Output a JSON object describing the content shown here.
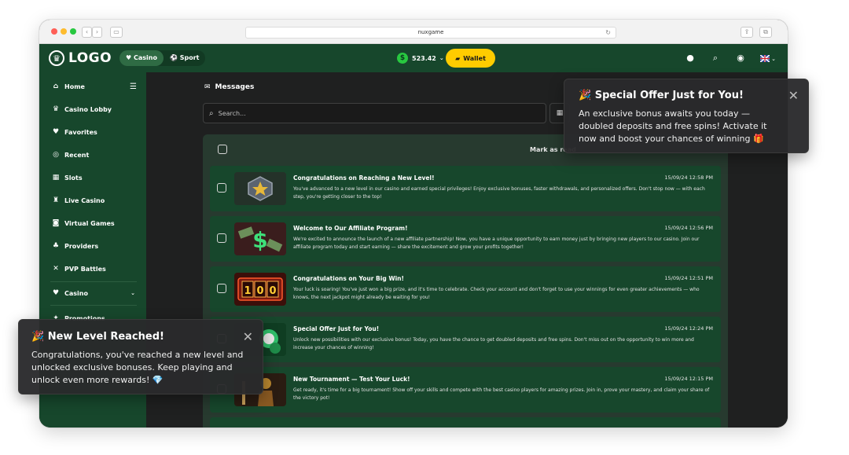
{
  "browser": {
    "url": "nuxgame",
    "reload_icon": "↻",
    "back_icon": "‹",
    "forward_icon": "›"
  },
  "topnav": {
    "logo_text": "LOGO",
    "tabs": [
      {
        "label": "Casino",
        "icon": "♥"
      },
      {
        "label": "Sport",
        "icon": "⚽"
      }
    ],
    "balance": "523.42",
    "currency_icon": "$",
    "wallet_label": "Wallet"
  },
  "sidebar": {
    "items": [
      {
        "label": "Home",
        "icon": "⌂"
      },
      {
        "label": "Casino Lobby",
        "icon": "♛"
      },
      {
        "label": "Favorites",
        "icon": "♥"
      },
      {
        "label": "Recent",
        "icon": "◎"
      },
      {
        "label": "Slots",
        "icon": "▦"
      },
      {
        "label": "Live Casino",
        "icon": "♜"
      },
      {
        "label": "Virtual Games",
        "icon": "◙"
      },
      {
        "label": "Providers",
        "icon": "♣"
      },
      {
        "label": "PVP Battles",
        "icon": "✕"
      },
      {
        "label": "Casino",
        "icon": "♥"
      },
      {
        "label": "Promotions",
        "icon": "✦"
      }
    ]
  },
  "messages": {
    "title": "Messages",
    "search_placeholder": "Search...",
    "mark_read_label": "Mark as read",
    "items": [
      {
        "title": "Congratulations on Reaching a New Level!",
        "date": "15/09/24 12:58 PM",
        "body": "You've advanced to a new level in our casino and earned special privileges! Enjoy exclusive bonuses, faster withdrawals, and personalized offers. Don't stop now — with each step, you're getting closer to the top!"
      },
      {
        "title": "Welcome to Our Affiliate Program!",
        "date": "15/09/24 12:56 PM",
        "body": "We're excited to announce the launch of a new affiliate partnership! Now, you have a unique opportunity to earn money just by bringing new players to our casino. Join our affiliate program today and start earning — share the excitement and grow your profits together!"
      },
      {
        "title": "Congratulations on Your Big Win!",
        "date": "15/09/24 12:51 PM",
        "body": "Your luck is soaring! You've just won a big prize, and it's time to celebrate. Check your account and don't forget to use your winnings for even greater achievements — who knows, the next jackpot might already be waiting for you!"
      },
      {
        "title": "Special Offer Just for You!",
        "date": "15/09/24 12:24 PM",
        "body": "Unlock new possibilities with our exclusive bonus! Today, you have the chance to get doubled deposits and free spins. Don't miss out on the opportunity to win more and increase your chances of winning!"
      },
      {
        "title": "New Tournament — Test Your Luck!",
        "date": "15/09/24 12:15 PM",
        "body": "Get ready, it's time for a big tournament! Show off your skills and compete with the best casino players for amazing prizes. Join in, prove your mastery, and claim your share of the victory pot!"
      }
    ]
  },
  "toasts": {
    "offer": {
      "title": "🎉 Special Offer Just for You!",
      "body": "An exclusive bonus awaits you today — doubled deposits and free spins! Activate it now and boost your chances of winning 🎁"
    },
    "level": {
      "title": "🎉 New Level Reached!",
      "body": "Congratulations, you've reached a new level and unlocked exclusive bonuses. Keep playing and unlock even more rewards! 💎"
    }
  },
  "colors": {
    "nav_green": "#17472c",
    "accent_yellow": "#ffcc00",
    "panel": "#273a2f"
  }
}
